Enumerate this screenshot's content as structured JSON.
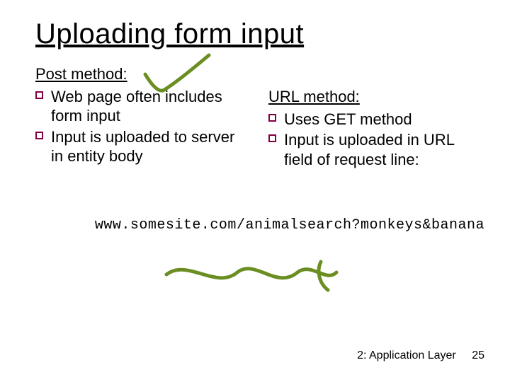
{
  "title": "Uploading form input",
  "left": {
    "heading": "Post method:",
    "items": [
      "Web page often includes form input",
      "Input is uploaded to server in entity body"
    ]
  },
  "right": {
    "heading": "URL method:",
    "items": [
      "Uses GET method",
      "Input is uploaded in URL field of request line:"
    ]
  },
  "url_example": "www.somesite.com/animalsearch?monkeys&banana",
  "footer": {
    "chapter": "2: Application Layer",
    "page": "25"
  }
}
